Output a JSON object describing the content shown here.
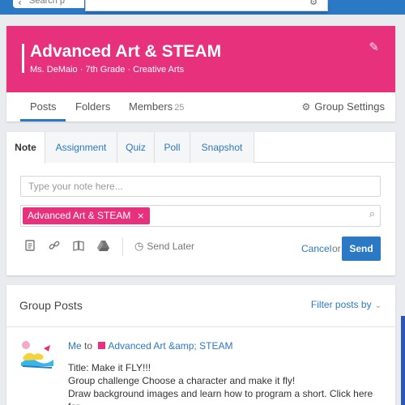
{
  "topbar": {
    "search_placeholder": "Search p",
    "back_icon": "chevron-left-icon",
    "dropdown_icon": "gear-icon"
  },
  "group": {
    "title": "Advanced Art & STEAM",
    "subtitle": "Ms. DeMaio · 7th Grade · Creative Arts",
    "color": "#e7317c",
    "tabs": [
      {
        "label": "Posts",
        "active": true
      },
      {
        "label": "Folders"
      },
      {
        "label": "Members",
        "count": "25"
      }
    ],
    "settings_label": "Group Settings"
  },
  "composer": {
    "tabs": [
      "Note",
      "Assignment",
      "Quiz",
      "Poll",
      "Snapshot"
    ],
    "note_placeholder": "Type your note here...",
    "recipient_chip": "Advanced Art & STEAM",
    "chip_close": "×",
    "tool_icons": [
      "file-icon",
      "link-icon",
      "library-icon",
      "google-drive-icon"
    ],
    "send_later_label": "Send Later",
    "cancel_label": "Cancel",
    "or_label": "or",
    "send_label": "Send"
  },
  "posts": {
    "title": "Group Posts",
    "filter_label": "Filter posts by",
    "items": [
      {
        "author": "Me",
        "to": "to",
        "group": "Advanced Art &amp; STEAM",
        "line1": "Title: Make it FLY!!!",
        "line2": "Group challenge Choose a character and make it fly!",
        "line3": "Draw background images and learn how to program a short. Click here for"
      }
    ]
  },
  "colors": {
    "accent": "#2b78c5",
    "brand": "#e7317c"
  }
}
